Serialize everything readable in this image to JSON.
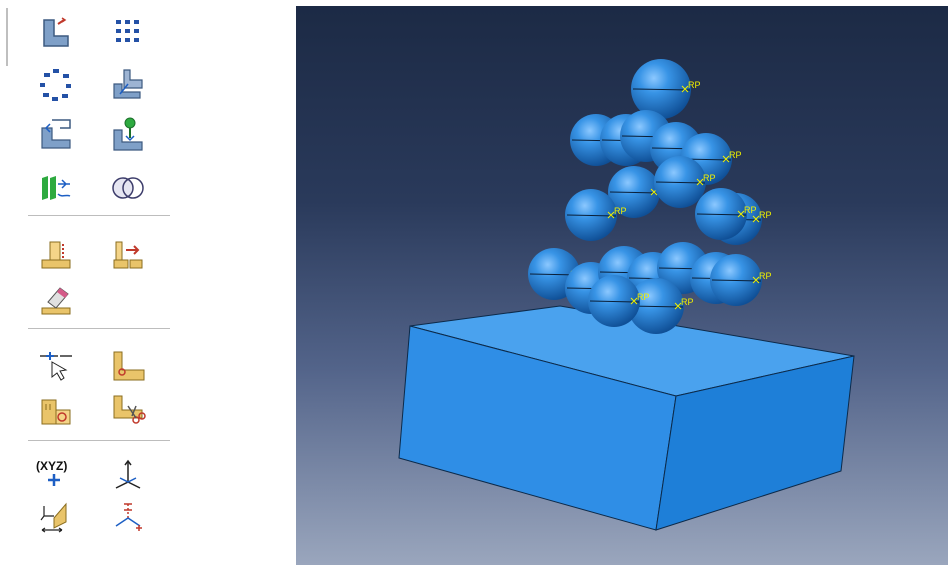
{
  "toolbox": {
    "tools": [
      {
        "name": "create-part-icon",
        "label": ""
      },
      {
        "name": "create-datum-points-icon",
        "label": ""
      },
      {
        "name": "circular-pattern-icon",
        "label": ""
      },
      {
        "name": "create-shell-icon",
        "label": ""
      },
      {
        "name": "merge-parts-icon",
        "label": ""
      },
      {
        "name": "reference-point-icon",
        "label": ""
      },
      {
        "name": "partition-face-icon",
        "label": ""
      },
      {
        "name": "boolean-union-icon",
        "label": ""
      },
      {
        "name": "extrude-cut-icon",
        "label": ""
      },
      {
        "name": "translate-feature-icon",
        "label": ""
      },
      {
        "name": "erase-feature-icon",
        "label": ""
      },
      {
        "name": "select-edge-icon",
        "label": ""
      },
      {
        "name": "fillet-icon",
        "label": ""
      },
      {
        "name": "partition-cell-icon",
        "label": ""
      },
      {
        "name": "cut-geometry-icon",
        "label": ""
      },
      {
        "name": "datum-point-xyz-icon",
        "label": "(XYZ)"
      },
      {
        "name": "datum-csys-icon",
        "label": ""
      },
      {
        "name": "datum-axis-plane-icon",
        "label": ""
      },
      {
        "name": "datum-offset-icon",
        "label": ""
      }
    ]
  },
  "viewport": {
    "rp_label": "RP",
    "colors": {
      "sphere": "#2c86d8",
      "block": "#2f8ee6",
      "rp_marker": "#f0f000"
    },
    "spheres": [
      {
        "id": "s1"
      },
      {
        "id": "s2"
      },
      {
        "id": "s3"
      },
      {
        "id": "s4"
      },
      {
        "id": "s5"
      },
      {
        "id": "s6"
      },
      {
        "id": "s7"
      },
      {
        "id": "s8"
      },
      {
        "id": "s9"
      },
      {
        "id": "s10"
      },
      {
        "id": "s11"
      },
      {
        "id": "s12"
      },
      {
        "id": "s13"
      },
      {
        "id": "s14"
      },
      {
        "id": "s15"
      },
      {
        "id": "s16"
      },
      {
        "id": "s17"
      },
      {
        "id": "s18"
      },
      {
        "id": "s19"
      },
      {
        "id": "s20"
      }
    ]
  }
}
